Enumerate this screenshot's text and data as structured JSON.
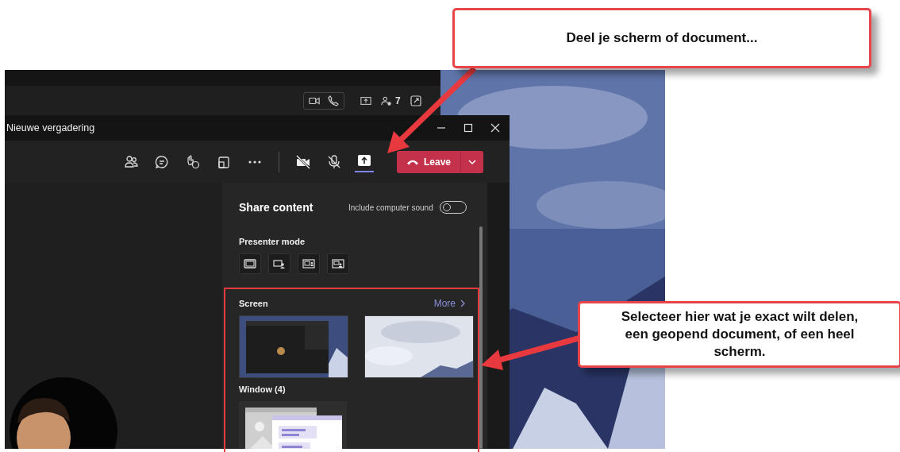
{
  "background_window": {
    "participant_count": "7"
  },
  "meeting_window": {
    "title": "Nieuwe vergadering",
    "share_selected": true,
    "leave_label": "Leave"
  },
  "share_panel": {
    "title": "Share content",
    "sound_label": "Include computer sound",
    "sound_on": false,
    "presenter_label": "Presenter mode",
    "screen_label": "Screen",
    "more_link": "More",
    "window_label": "Window (4)"
  },
  "callouts": [
    {
      "text": "Deel je scherm of document..."
    },
    {
      "text": "Selecteer hier wat je exact wilt delen, een geopend document, of een heel scherm."
    }
  ]
}
